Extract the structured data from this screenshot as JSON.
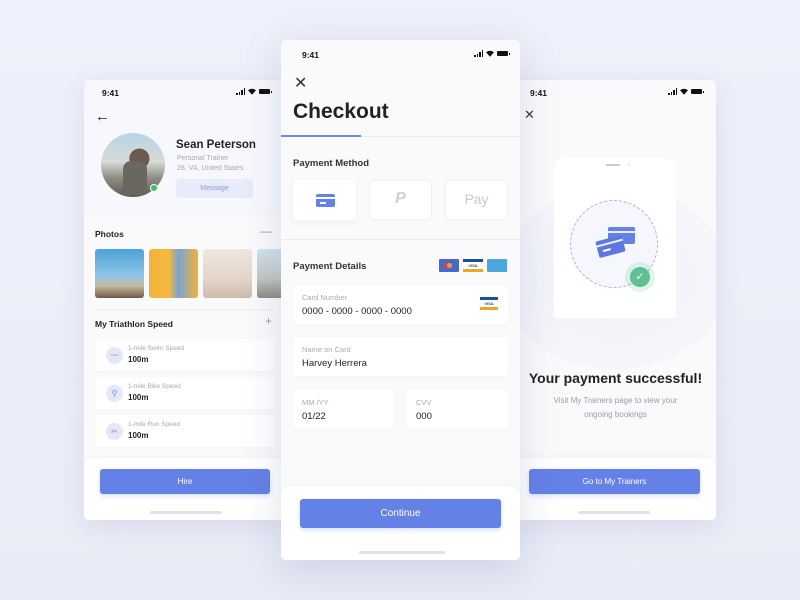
{
  "status_bar": {
    "time": "9:41"
  },
  "profile": {
    "name": "Sean Peterson",
    "role": "Personal Trainer",
    "location": "28, VA, United States",
    "message_label": "Message",
    "online_status": "online",
    "photos_title": "Photos",
    "photos_action_icon": "minus-icon",
    "speed_title": "My Triathlon Speed",
    "speed_action_icon": "plus-icon",
    "speeds": [
      {
        "icon": "swim-icon",
        "glyph": "〰",
        "label": "1-mile Swim Speed",
        "value": "100m"
      },
      {
        "icon": "bike-icon",
        "glyph": "⚲",
        "label": "1-mile Bike Speed",
        "value": "100m"
      },
      {
        "icon": "run-icon",
        "glyph": "✂",
        "label": "1-mile Run Speed",
        "value": "100m"
      }
    ],
    "hire_label": "Hire"
  },
  "checkout": {
    "title": "Checkout",
    "payment_method_title": "Payment Method",
    "methods": [
      {
        "name": "card",
        "selected": true
      },
      {
        "name": "PayPal",
        "glyph": "P",
        "selected": false
      },
      {
        "name": "Apple Pay",
        "glyph": " Pay",
        "selected": false
      }
    ],
    "payment_details_title": "Payment Details",
    "card_brands": [
      "Mastercard",
      "VISA",
      "American Express"
    ],
    "visa_text": "VISA",
    "fields": {
      "card_number": {
        "label": "Card Number",
        "value": "0000 - 0000 - 0000 - 0000"
      },
      "name_on_card": {
        "label": "Name on Card",
        "value": "Harvey Herrera"
      },
      "expiry": {
        "label": "MM /YY",
        "value": "01/22"
      },
      "cvv": {
        "label": "CVV",
        "value": "000"
      }
    },
    "continue_label": "Continue"
  },
  "success": {
    "title": "Your payment successful!",
    "subtitle": "Visit My Trainers page to view your ongoing bookings",
    "check_glyph": "✓",
    "button_label": "Go to My Trainers"
  },
  "colors": {
    "accent": "#6381e6",
    "success": "#5fc093",
    "online": "#34c759"
  }
}
